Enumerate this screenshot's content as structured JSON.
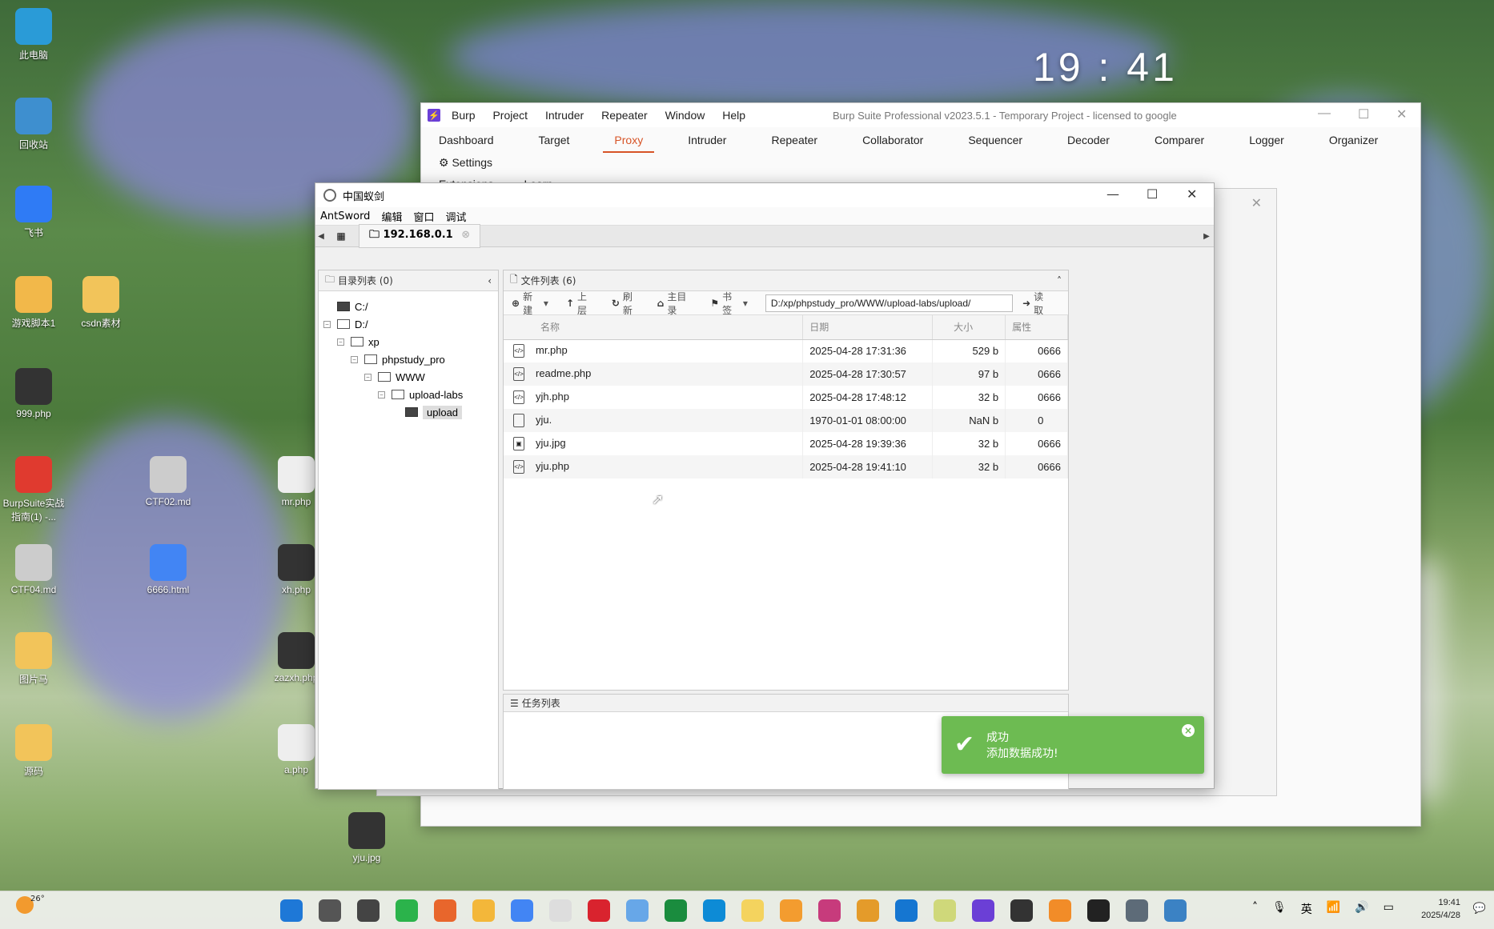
{
  "desktop": {
    "icons": [
      {
        "label": "此电脑",
        "color": "#2a9bd7"
      },
      {
        "label": "回收站",
        "color": "#3e8fcf"
      },
      {
        "label": "飞书",
        "color": "#2f7bf5"
      },
      {
        "label": "游戏脚本1",
        "color": "#f2b84a"
      },
      {
        "label": "csdn素材",
        "color": "#f2c45a"
      },
      {
        "label": "999.php",
        "color": "#333333"
      },
      {
        "label": "BurpSuite实战指南(1) -...",
        "color": "#e03a2f"
      },
      {
        "label": "CTF02.md",
        "color": "#cccccc"
      },
      {
        "label": "mr.php",
        "color": "#eeeeee"
      },
      {
        "label": "CTF04.md",
        "color": "#cccccc"
      },
      {
        "label": "6666.html",
        "color": "#4285f4"
      },
      {
        "label": "xh.php",
        "color": "#333333"
      },
      {
        "label": "图片马",
        "color": "#f2c45a"
      },
      {
        "label": "zazxh.php",
        "color": "#333333"
      },
      {
        "label": "源码",
        "color": "#f2c45a"
      },
      {
        "label": "a.php",
        "color": "#eeeeee"
      },
      {
        "label": "yju.jpg",
        "color": "#333333"
      }
    ],
    "clock": "19 : 41"
  },
  "burp": {
    "menu": [
      "Burp",
      "Project",
      "Intruder",
      "Repeater",
      "Window",
      "Help"
    ],
    "window_title": "Burp Suite Professional v2023.5.1 - Temporary Project - licensed to google",
    "tabs": [
      "Dashboard",
      "Target",
      "Proxy",
      "Intruder",
      "Repeater",
      "Collaborator",
      "Sequencer",
      "Decoder",
      "Comparer",
      "Logger",
      "Organizer"
    ],
    "active_tab": "Proxy",
    "settings_label": "Settings",
    "tabs_row2": [
      "Extensions",
      "Learn"
    ]
  },
  "antsword": {
    "title": "中国蚁剑",
    "menu": [
      "AntSword",
      "编辑",
      "窗口",
      "调试"
    ],
    "host_tab": "192.168.0.1",
    "dir_panel_title": "目录列表 (0)",
    "tree": [
      {
        "label": "C:/",
        "dark": true,
        "level": 0,
        "expander": false
      },
      {
        "label": "D:/",
        "dark": false,
        "level": 0,
        "expander": true
      },
      {
        "label": "xp",
        "dark": false,
        "level": 1,
        "expander": true
      },
      {
        "label": "phpstudy_pro",
        "dark": false,
        "level": 2,
        "expander": true
      },
      {
        "label": "WWW",
        "dark": false,
        "level": 3,
        "expander": true
      },
      {
        "label": "upload-labs",
        "dark": false,
        "level": 4,
        "expander": true
      },
      {
        "label": "upload",
        "dark": true,
        "level": 5,
        "expander": false,
        "selected": true
      }
    ],
    "file_panel_title": "文件列表 (6)",
    "toolbar": {
      "new": "新建",
      "up": "上层",
      "refresh": "刷新",
      "home": "主目录",
      "bookmark": "书签",
      "path": "D:/xp/phpstudy_pro/WWW/upload-labs/upload/",
      "read": "读取"
    },
    "columns": [
      "名称",
      "日期",
      "大小",
      "属性"
    ],
    "files": [
      {
        "name": "mr.php",
        "date": "2025-04-28 17:31:36",
        "size": "529 b",
        "attr": "0666",
        "icon": "php"
      },
      {
        "name": "readme.php",
        "date": "2025-04-28 17:30:57",
        "size": "97 b",
        "attr": "0666",
        "icon": "php"
      },
      {
        "name": "yjh.php",
        "date": "2025-04-28 17:48:12",
        "size": "32 b",
        "attr": "0666",
        "icon": "php"
      },
      {
        "name": "yju.",
        "date": "1970-01-01 08:00:00",
        "size": "NaN b",
        "attr": "0",
        "icon": "file"
      },
      {
        "name": "yju.jpg",
        "date": "2025-04-28 19:39:36",
        "size": "32 b",
        "attr": "0666",
        "icon": "image"
      },
      {
        "name": "yju.php",
        "date": "2025-04-28 19:41:10",
        "size": "32 b",
        "attr": "0666",
        "icon": "php"
      }
    ],
    "task_panel_title": "任务列表",
    "toast": {
      "title": "成功",
      "message": "添加数据成功!"
    }
  },
  "taskbar": {
    "weather": "26°",
    "time": "19:41",
    "date": "2025/4/28",
    "ime": "英"
  }
}
